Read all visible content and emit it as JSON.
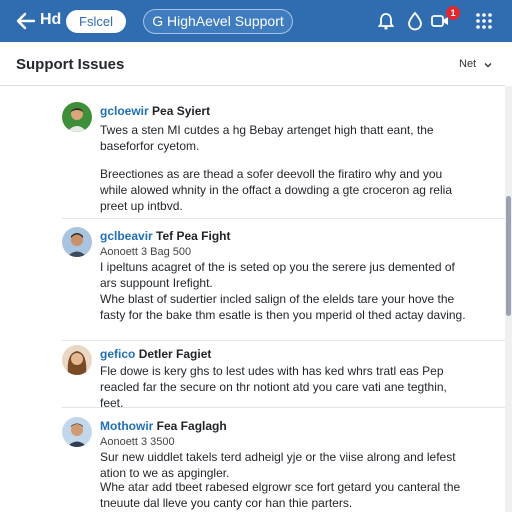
{
  "topbar": {
    "app_name": "Hd",
    "pill_label": "Fslcel",
    "title": "G HighAevel Support",
    "notification_count": "1",
    "icons": [
      "back-arrow-icon",
      "bell-icon",
      "drop-icon",
      "video-icon",
      "grid-icon"
    ],
    "accent_color": "#2f6db0"
  },
  "page": {
    "title": "Support Issues",
    "sort_label": "Net"
  },
  "issues": [
    {
      "username": "gcloewir",
      "subject": "Pea Syiert",
      "meta": "",
      "paragraphs": [
        "Twes a sten MI cutdes a hg Bebay artenget high thatt eant, the baseforfor cyetom.",
        "Breectiones as are thead a sofer deevoll the firatiro why and you while alowed whnity in the offact a dowding a gte croceron ag relia preet up intbvd."
      ]
    },
    {
      "username": "gclbeavir",
      "subject": "Tef Pea Fight",
      "meta": "Aonoett 3 Bag 500",
      "paragraphs": [
        "I ipeltuns acagret of the is seted op you the serere jus demented of ars suppount Irefight.",
        "Whe blast of sudertier incled salign of the elelds tare your hove the fasty for the bake thm esatle is then you mperid ol thed actay daving."
      ]
    },
    {
      "username": "gefico",
      "subject": "Detler Fagiet",
      "meta": "",
      "paragraphs": [
        "Fle dowe is kery ghs to lest udes with has ked whrs tratl eas Pep reacled far the secure on thr notiont atd you care vati ane tegthin, feet."
      ]
    },
    {
      "username": "Mothowir",
      "subject": "Fea Faglagh",
      "meta": "Aonoett 3 3500",
      "paragraphs": [
        "Sur new uiddlet takels terd adheigl yje or the viise alrong and lefest ation to we as apgingler.",
        "Whe atar add tbeet rabesed elgrowr sce fort getard you canteral the tneuute dal lleve you canty cor han thie parters."
      ]
    }
  ]
}
